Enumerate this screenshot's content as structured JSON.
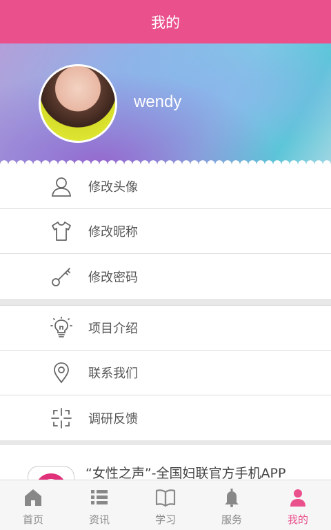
{
  "header": {
    "title": "我的"
  },
  "profile": {
    "username": "wendy"
  },
  "menu_groups": [
    {
      "items": [
        {
          "label": "修改头像",
          "icon": "user-icon"
        },
        {
          "label": "修改昵称",
          "icon": "shirt-icon"
        },
        {
          "label": "修改密码",
          "icon": "key-icon"
        }
      ]
    },
    {
      "items": [
        {
          "label": "项目介绍",
          "icon": "lightbulb-icon"
        },
        {
          "label": "联系我们",
          "icon": "location-pin-icon"
        },
        {
          "label": "调研反馈",
          "icon": "crosshair-icon"
        }
      ]
    }
  ],
  "promo": {
    "text": "“女性之声”-全国妇联官方手机APP"
  },
  "tabs": [
    {
      "label": "首页",
      "icon": "home-icon",
      "active": false
    },
    {
      "label": "资讯",
      "icon": "list-icon",
      "active": false
    },
    {
      "label": "学习",
      "icon": "book-icon",
      "active": false
    },
    {
      "label": "服务",
      "icon": "bell-icon",
      "active": false
    },
    {
      "label": "我的",
      "icon": "person-icon",
      "active": true
    }
  ],
  "colors": {
    "accent": "#e9508c",
    "inactive": "#888888"
  }
}
